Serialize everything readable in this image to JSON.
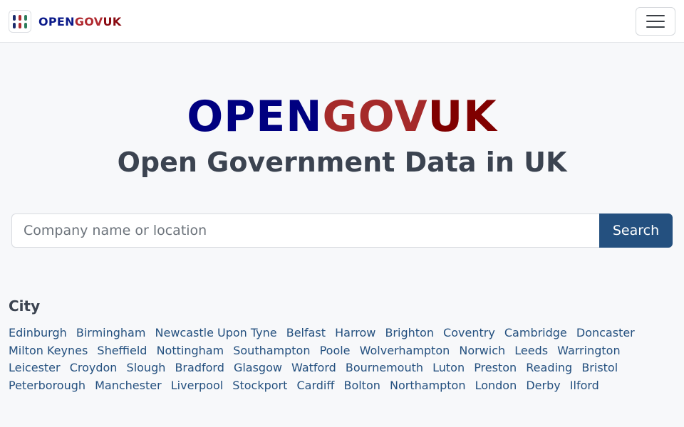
{
  "navbar": {
    "brand": {
      "open": "OPEN",
      "gov": "GOV",
      "uk": "UK"
    },
    "logo_icon": "grid-dots-icon",
    "menu_icon": "hamburger-menu-icon"
  },
  "hero": {
    "title": {
      "open": "OPEN",
      "gov": "GOV",
      "uk": "UK"
    },
    "subtitle": "Open Government Data in UK"
  },
  "search": {
    "placeholder": "Company name or location",
    "value": "",
    "button_label": "Search"
  },
  "cities": {
    "heading": "City",
    "items": [
      "Edinburgh",
      "Birmingham",
      "Newcastle Upon Tyne",
      "Belfast",
      "Harrow",
      "Brighton",
      "Coventry",
      "Cambridge",
      "Doncaster",
      "Milton Keynes",
      "Sheffield",
      "Nottingham",
      "Southampton",
      "Poole",
      "Wolverhampton",
      "Norwich",
      "Leeds",
      "Warrington",
      "Leicester",
      "Croydon",
      "Slough",
      "Bradford",
      "Glasgow",
      "Watford",
      "Bournemouth",
      "Luton",
      "Preston",
      "Reading",
      "Bristol",
      "Peterborough",
      "Manchester",
      "Liverpool",
      "Stockport",
      "Cardiff",
      "Bolton",
      "Northampton",
      "London",
      "Derby",
      "Ilford"
    ]
  },
  "colors": {
    "logo_dots": [
      "#1b2a6b",
      "#b02a30",
      "#2e7d5b",
      "#1b2a6b",
      "#b02a30",
      "#2e7d5b"
    ],
    "search_button": "#24507f",
    "link": "#24507f"
  }
}
